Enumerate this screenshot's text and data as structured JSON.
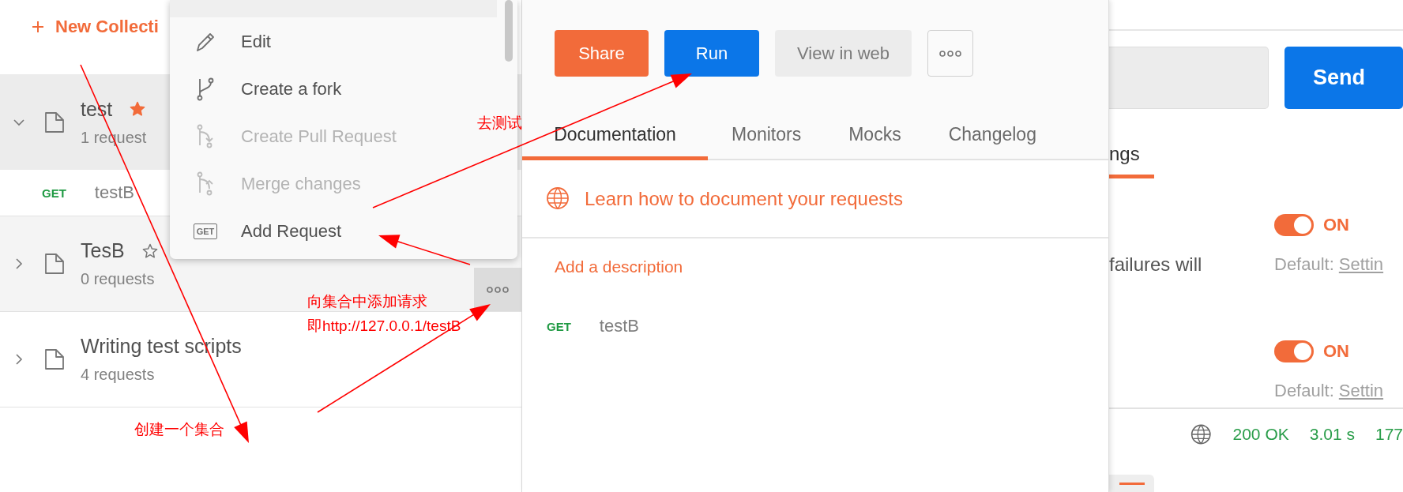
{
  "sidebar": {
    "new_collection": "New Collecti",
    "collections": [
      {
        "name": "test",
        "count": "1 request",
        "starred": true,
        "expanded": true,
        "selected": true,
        "hovered": false,
        "requests": [
          {
            "method": "GET",
            "name": "testB"
          }
        ]
      },
      {
        "name": "TesB",
        "count": "0 requests",
        "starred": false,
        "expanded": false,
        "selected": false,
        "hovered": true
      },
      {
        "name": "Writing test scripts",
        "count": "4 requests",
        "starred": false,
        "expanded": false,
        "selected": false,
        "hovered": false
      }
    ]
  },
  "context_menu": {
    "items": [
      {
        "kind": "edit",
        "label": "Edit",
        "disabled": false
      },
      {
        "kind": "fork",
        "label": "Create a fork",
        "disabled": false
      },
      {
        "kind": "pull",
        "label": "Create Pull Request",
        "disabled": true
      },
      {
        "kind": "merge",
        "label": "Merge changes",
        "disabled": true
      },
      {
        "kind": "request",
        "label": "Add Request",
        "badge": "GET",
        "disabled": false
      }
    ]
  },
  "collection_panel": {
    "buttons": [
      {
        "kind": "share",
        "label": "Share"
      },
      {
        "kind": "run",
        "label": "Run"
      },
      {
        "kind": "web",
        "label": "View in web"
      },
      {
        "kind": "more"
      }
    ],
    "tabs": [
      {
        "label": "Documentation",
        "selected": true
      },
      {
        "label": "Monitors",
        "selected": false
      },
      {
        "label": "Mocks",
        "selected": false
      },
      {
        "label": "Changelog",
        "selected": false
      }
    ],
    "learn_link": "Learn how to document your requests",
    "add_description": "Add a description",
    "requests": [
      {
        "method": "GET",
        "name": "testB"
      }
    ]
  },
  "request_panel": {
    "send": "Send",
    "tab": "ngs",
    "settings": [
      {
        "text": "failures will",
        "on": true,
        "state": "ON",
        "default_label": "Default:",
        "default_link": "Settin"
      },
      {
        "on": true,
        "state": "ON",
        "default_label": "Default:",
        "default_link": "Settin"
      }
    ],
    "status": {
      "code": "200 OK",
      "time": "3.01 s",
      "size": "177"
    }
  },
  "annotations": [
    "去测试",
    "向集合中添加请求",
    "即http://127.0.0.1/testB",
    "创建一个集合"
  ]
}
